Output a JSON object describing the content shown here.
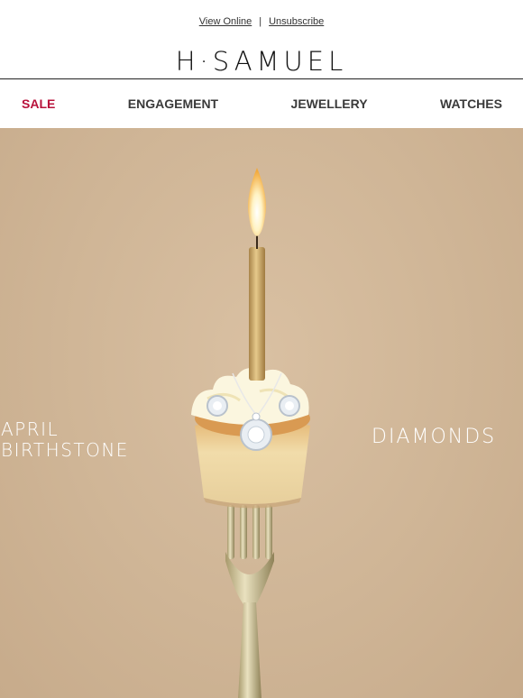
{
  "header": {
    "view_online": "View Online",
    "separator": "|",
    "unsubscribe": "Unsubscribe"
  },
  "brand": {
    "logo_text": "H·SAMUEL"
  },
  "nav": {
    "items": [
      {
        "label": "SALE",
        "color": "#b8123b"
      },
      {
        "label": "ENGAGEMENT"
      },
      {
        "label": "JEWELLERY"
      },
      {
        "label": "WATCHES"
      }
    ]
  },
  "hero": {
    "left_line1": "APRIL",
    "left_line2": "BIRTHSTONE",
    "right_text": "DIAMONDS",
    "background": "#d3b898",
    "image_description_icons": [
      "candle-icon",
      "cupcake-icon",
      "fork-icon",
      "diamond-pendant-icon",
      "diamond-earring-icon"
    ]
  }
}
